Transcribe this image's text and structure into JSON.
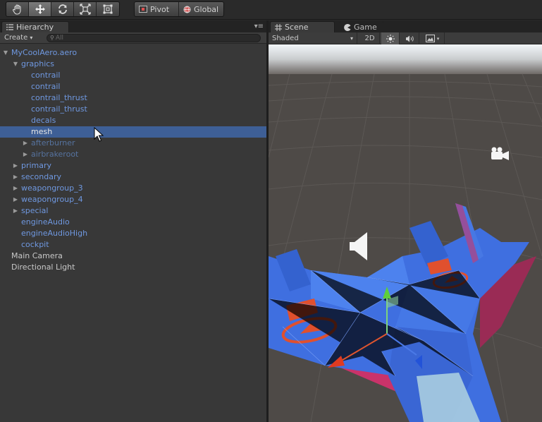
{
  "toolbar": {
    "tools": [
      "hand-tool",
      "move-tool",
      "rotate-tool",
      "scale-tool",
      "rect-tool"
    ],
    "pivot_label": "Pivot",
    "global_label": "Global"
  },
  "hierarchy": {
    "tab_label": "Hierarchy",
    "create_label": "Create",
    "search_placeholder": "All",
    "items": [
      {
        "label": "MyCoolAero.aero",
        "depth": 0,
        "arrow": "expanded",
        "style": "blue"
      },
      {
        "label": "graphics",
        "depth": 1,
        "arrow": "expanded",
        "style": "blue"
      },
      {
        "label": "contrail",
        "depth": 2,
        "arrow": "none",
        "style": "blue"
      },
      {
        "label": "contrail",
        "depth": 2,
        "arrow": "none",
        "style": "blue"
      },
      {
        "label": "contrail_thrust",
        "depth": 2,
        "arrow": "none",
        "style": "blue"
      },
      {
        "label": "contrail_thrust",
        "depth": 2,
        "arrow": "none",
        "style": "blue"
      },
      {
        "label": "decals",
        "depth": 2,
        "arrow": "none",
        "style": "blue"
      },
      {
        "label": "mesh",
        "depth": 2,
        "arrow": "none",
        "style": "selected"
      },
      {
        "label": "afterburner",
        "depth": 2,
        "arrow": "collapsed",
        "style": "dim"
      },
      {
        "label": "airbrakeroot",
        "depth": 2,
        "arrow": "collapsed",
        "style": "dim"
      },
      {
        "label": "primary",
        "depth": 1,
        "arrow": "collapsed",
        "style": "blue"
      },
      {
        "label": "secondary",
        "depth": 1,
        "arrow": "collapsed",
        "style": "blue"
      },
      {
        "label": "weapongroup_3",
        "depth": 1,
        "arrow": "collapsed",
        "style": "blue"
      },
      {
        "label": "weapongroup_4",
        "depth": 1,
        "arrow": "collapsed",
        "style": "blue"
      },
      {
        "label": "special",
        "depth": 1,
        "arrow": "collapsed",
        "style": "blue"
      },
      {
        "label": "engineAudio",
        "depth": 1,
        "arrow": "none",
        "style": "blue"
      },
      {
        "label": "engineAudioHigh",
        "depth": 1,
        "arrow": "none",
        "style": "blue"
      },
      {
        "label": "cockpit",
        "depth": 1,
        "arrow": "none",
        "style": "blue"
      },
      {
        "label": "Main Camera",
        "depth": 0,
        "arrow": "none",
        "style": "white"
      },
      {
        "label": "Directional Light",
        "depth": 0,
        "arrow": "none",
        "style": "white"
      }
    ]
  },
  "scene": {
    "tab_scene": "Scene",
    "tab_game": "Game",
    "shading_mode": "Shaded",
    "mode_2d": "2D"
  },
  "colors": {
    "selection": "#3e5f96",
    "prefab_blue": "#6f98e0",
    "model_blue": "#3f6fe0",
    "accent_red": "#e0502e",
    "ground": "#4e4a47"
  }
}
